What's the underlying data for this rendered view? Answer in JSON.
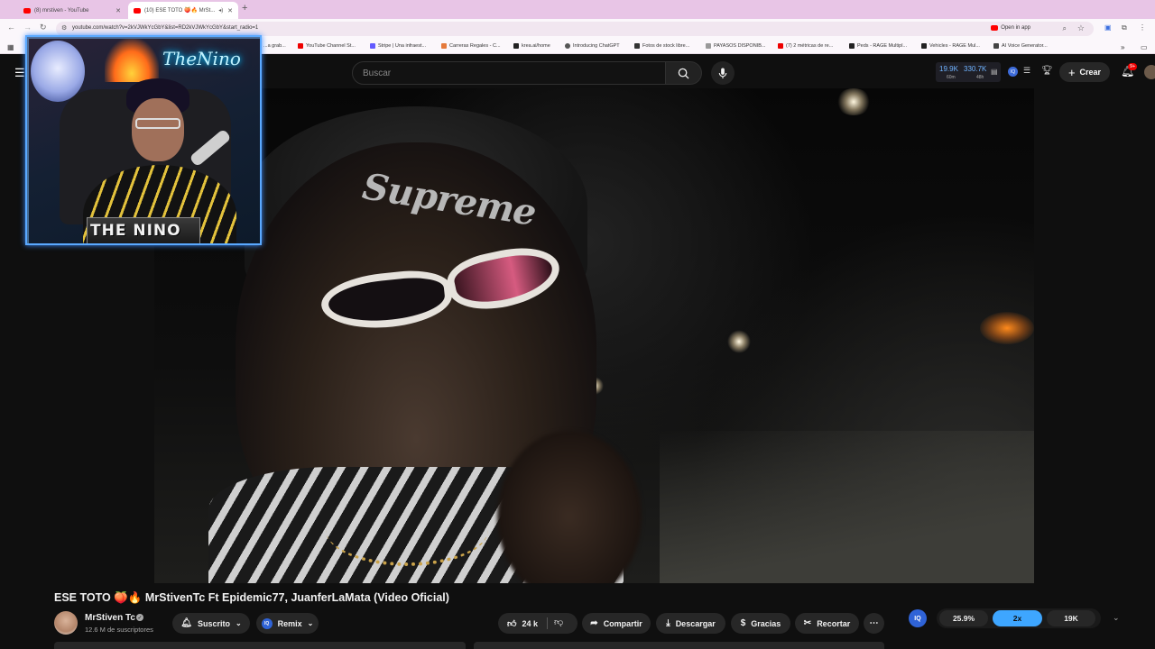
{
  "browser": {
    "tabs": [
      {
        "label": "(8) mrstiven - YouTube"
      },
      {
        "label": "(10) ESE TOTO 🍑🔥 MrSt..."
      }
    ],
    "url": "youtube.com/watch?v=2kVJWkYcGbY&list=RD2kVJWkYcGbY&start_radio=1",
    "open_in_app": "Open in app",
    "bookmarks": [
      "...a grab...",
      "YouTube Channel St...",
      "Stripe | Una infraest...",
      "Carreras Regales - C...",
      "krea.ai/home",
      "Introducing ChatGPT",
      "Fotos de stock libre...",
      "PAYASOS DISPONIB...",
      "(7) 2 métricas de re...",
      "Peds - RAGE Multipl...",
      "Vehicles - RAGE Mul...",
      "AI Voice Generator..."
    ]
  },
  "header": {
    "search_placeholder": "Buscar",
    "stats": {
      "views": "19.9K",
      "views_period": "60m",
      "total": "330.7K",
      "total_period": "48h"
    },
    "iq_label": "IQ",
    "create_label": "Crear",
    "notification_count": "9+"
  },
  "overlay": {
    "neon_text": "TheNino",
    "name_plate": "THE NINO"
  },
  "video_scene": {
    "beanie_text": "Supreme"
  },
  "video": {
    "title": "ESE TOTO 🍑🔥 MrStivenTc Ft Epidemic77, JuanferLaMata (Video Oficial)",
    "channel": "MrStiven Tc",
    "subscribers": "12.6 M de suscriptores",
    "subscribed_label": "Suscrito",
    "remix_label": "Remix",
    "likes": "24 k",
    "share_label": "Compartir",
    "download_label": "Descargar",
    "thanks_label": "Gracias",
    "clip_label": "Recortar"
  },
  "iq_widget": {
    "label": "IQ",
    "percent": "25.9%",
    "multiplier": "2x",
    "count": "19K"
  },
  "colors": {
    "yt_bg": "#0f0f0f",
    "pill_bg": "#272727",
    "iq_blue": "#2f63d7",
    "multiplier_blue": "#3ea6ff",
    "tabstrip_pink": "#e8c5e6"
  }
}
